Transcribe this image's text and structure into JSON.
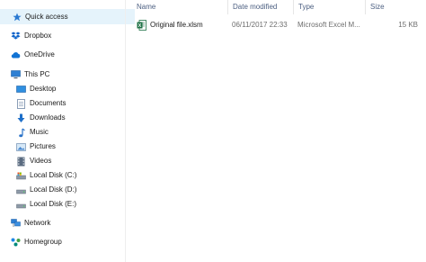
{
  "nav": {
    "quick_access": "Quick access",
    "dropbox": "Dropbox",
    "onedrive": "OneDrive",
    "this_pc": "This PC",
    "desktop": "Desktop",
    "documents": "Documents",
    "downloads": "Downloads",
    "music": "Music",
    "pictures": "Pictures",
    "videos": "Videos",
    "disk_c": "Local Disk (C:)",
    "disk_d": "Local Disk (D:)",
    "disk_e": "Local Disk (E:)",
    "network": "Network",
    "homegroup": "Homegroup"
  },
  "columns": {
    "name": "Name",
    "date_modified": "Date modified",
    "type": "Type",
    "size": "Size"
  },
  "files": [
    {
      "name": "Original file.xlsm",
      "date_modified": "06/11/2017 22:33",
      "type": "Microsoft Excel M...",
      "size": "15 KB",
      "icon": "excel-file-icon"
    }
  ],
  "colors": {
    "accent": "#0078d7",
    "selection": "#e5f3fb",
    "header_text": "#4d6082",
    "excel_green": "#1e7145"
  }
}
